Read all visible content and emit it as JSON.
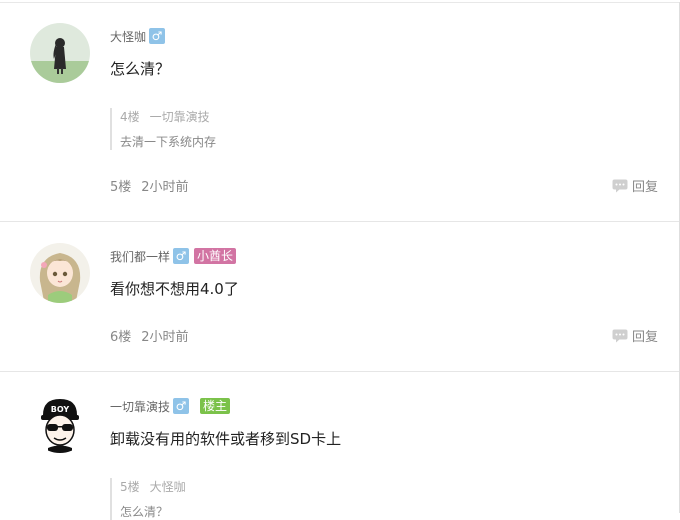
{
  "posts": [
    {
      "username": "大怪咖",
      "gender_symbol": "♂",
      "content": "怎么清？",
      "quote": {
        "floor": "4楼",
        "author": "一切靠演技",
        "text": "去清一下系统内存"
      },
      "floor": "5楼",
      "time": "2小时前",
      "reply_label": "回复"
    },
    {
      "username": "我们都一样",
      "gender_symbol": "♂",
      "badge": "小酋长",
      "content": "看你想不想用4.0了",
      "floor": "6楼",
      "time": "2小时前",
      "reply_label": "回复"
    },
    {
      "username": "一切靠演技",
      "gender_symbol": "♂",
      "badge": "楼主",
      "content": "卸载没有用的软件或者移到SD卡上",
      "quote": {
        "floor": "5楼",
        "author": "大怪咖",
        "text": "怎么清？"
      }
    }
  ],
  "avatar3_text": "BOY",
  "colors": {
    "gender_badge": "#8fc3e8",
    "rank_badge": "#d274a3",
    "host_badge": "#7bc24a"
  }
}
